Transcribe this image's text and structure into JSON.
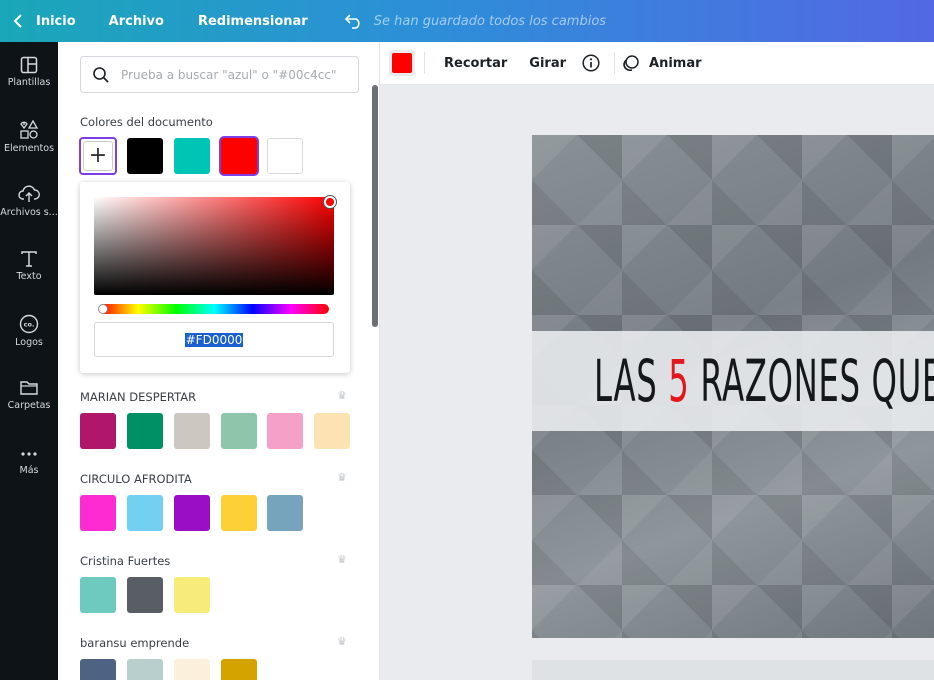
{
  "topbar": {
    "home": "Inicio",
    "file": "Archivo",
    "resize": "Redimensionar",
    "save_status": "Se han guardado todos los cambios"
  },
  "rail": {
    "items": [
      {
        "label": "Plantillas",
        "icon": "templates-icon"
      },
      {
        "label": "Elementos",
        "icon": "elements-icon"
      },
      {
        "label": "Archivos s...",
        "icon": "upload-cloud-icon"
      },
      {
        "label": "Texto",
        "icon": "text-icon"
      },
      {
        "label": "Logos",
        "icon": "logo-icon"
      },
      {
        "label": "Carpetas",
        "icon": "folder-icon"
      },
      {
        "label": "Más",
        "icon": "more-icon"
      }
    ]
  },
  "search": {
    "placeholder": "Prueba a buscar \"azul\" o \"#00c4cc\""
  },
  "document_colors": {
    "title": "Colores del documento",
    "swatches": [
      "#000000",
      "#00c4b4",
      "#fd0000",
      "#ffffff"
    ],
    "selected": "#fd0000"
  },
  "picker": {
    "hex": "#FD0000"
  },
  "palettes": [
    {
      "name": "MARIAN DESPERTAR",
      "colors": [
        "#b0176a",
        "#009065",
        "#cdc7c2",
        "#8fc5aa",
        "#f5a0c6",
        "#fbe3b3"
      ]
    },
    {
      "name": "CIRCULO AFRODITA",
      "colors": [
        "#ff2bd2",
        "#74d0f0",
        "#9a0fc6",
        "#fdd135",
        "#76a4bc"
      ]
    },
    {
      "name": "Cristina Fuertes",
      "colors": [
        "#6ec9bf",
        "#595e65",
        "#f7ec79"
      ]
    },
    {
      "name": "baransu emprende",
      "colors": [
        "#4e6381",
        "#b8cfcd",
        "#fbf0dc",
        "#d4a300"
      ]
    }
  ],
  "toolbar": {
    "color": "#fd0000",
    "crop": "Recortar",
    "flip": "Girar",
    "animate": "Animar"
  },
  "canvas": {
    "headline_part1": "LAS ",
    "headline_number": "5",
    "headline_part2": " RAZONES QUE TE H"
  }
}
